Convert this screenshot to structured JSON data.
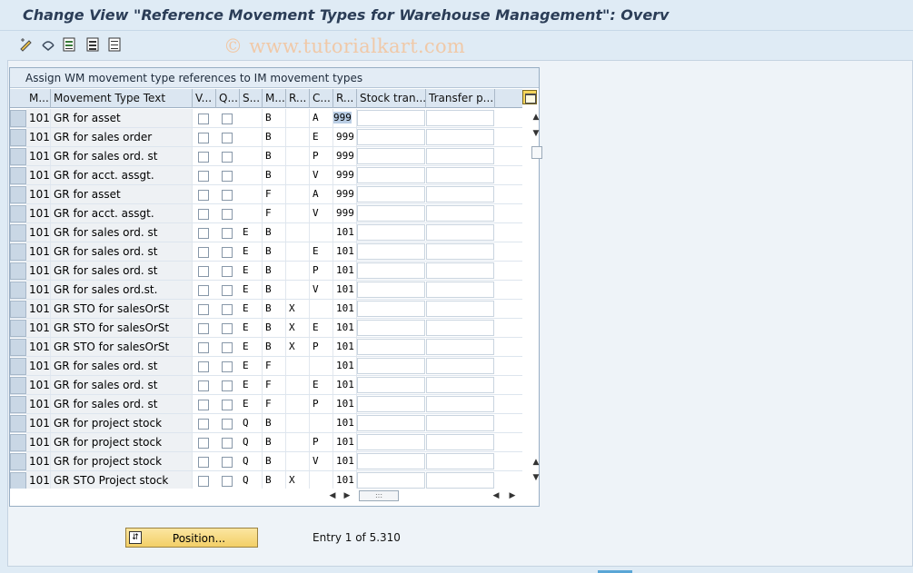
{
  "title": "Change View \"Reference Movement Types for Warehouse Management\": Overv",
  "watermark": "© www.tutorialkart.com",
  "toolbar": {
    "icons": [
      "change-display-icon",
      "other-view-icon",
      "details-icon",
      "select-all-icon",
      "deselect-icon"
    ]
  },
  "table": {
    "caption": "Assign WM movement type references to IM movement types",
    "columns": [
      "M...",
      "Movement Type Text",
      "V...",
      "Q...",
      "S...",
      "M...",
      "R...",
      "C...",
      "R...",
      "Stock tran...",
      "Transfer p..."
    ],
    "rows": [
      {
        "mvt": "101",
        "text": "GR for asset",
        "s": "",
        "m": "B",
        "r": "",
        "c": "A",
        "ref": "999"
      },
      {
        "mvt": "101",
        "text": "GR for sales order",
        "s": "",
        "m": "B",
        "r": "",
        "c": "E",
        "ref": "999"
      },
      {
        "mvt": "101",
        "text": "GR for sales ord. st",
        "s": "",
        "m": "B",
        "r": "",
        "c": "P",
        "ref": "999"
      },
      {
        "mvt": "101",
        "text": "GR for acct. assgt.",
        "s": "",
        "m": "B",
        "r": "",
        "c": "V",
        "ref": "999"
      },
      {
        "mvt": "101",
        "text": "GR for asset",
        "s": "",
        "m": "F",
        "r": "",
        "c": "A",
        "ref": "999"
      },
      {
        "mvt": "101",
        "text": "GR for acct. assgt.",
        "s": "",
        "m": "F",
        "r": "",
        "c": "V",
        "ref": "999"
      },
      {
        "mvt": "101",
        "text": "GR for sales ord. st",
        "s": "E",
        "m": "B",
        "r": "",
        "c": "",
        "ref": "101"
      },
      {
        "mvt": "101",
        "text": "GR for sales ord. st",
        "s": "E",
        "m": "B",
        "r": "",
        "c": "E",
        "ref": "101"
      },
      {
        "mvt": "101",
        "text": "GR for sales ord. st",
        "s": "E",
        "m": "B",
        "r": "",
        "c": "P",
        "ref": "101"
      },
      {
        "mvt": "101",
        "text": "GR for sales ord.st.",
        "s": "E",
        "m": "B",
        "r": "",
        "c": "V",
        "ref": "101"
      },
      {
        "mvt": "101",
        "text": "GR STO for salesOrSt",
        "s": "E",
        "m": "B",
        "r": "X",
        "c": "",
        "ref": "101"
      },
      {
        "mvt": "101",
        "text": "GR STO for salesOrSt",
        "s": "E",
        "m": "B",
        "r": "X",
        "c": "E",
        "ref": "101"
      },
      {
        "mvt": "101",
        "text": "GR STO for salesOrSt",
        "s": "E",
        "m": "B",
        "r": "X",
        "c": "P",
        "ref": "101"
      },
      {
        "mvt": "101",
        "text": "GR for sales ord. st",
        "s": "E",
        "m": "F",
        "r": "",
        "c": "",
        "ref": "101"
      },
      {
        "mvt": "101",
        "text": "GR for sales ord. st",
        "s": "E",
        "m": "F",
        "r": "",
        "c": "E",
        "ref": "101"
      },
      {
        "mvt": "101",
        "text": "GR for sales ord. st",
        "s": "E",
        "m": "F",
        "r": "",
        "c": "P",
        "ref": "101"
      },
      {
        "mvt": "101",
        "text": "GR for project stock",
        "s": "Q",
        "m": "B",
        "r": "",
        "c": "",
        "ref": "101"
      },
      {
        "mvt": "101",
        "text": "GR for project stock",
        "s": "Q",
        "m": "B",
        "r": "",
        "c": "P",
        "ref": "101"
      },
      {
        "mvt": "101",
        "text": "GR for project stock",
        "s": "Q",
        "m": "B",
        "r": "",
        "c": "V",
        "ref": "101"
      },
      {
        "mvt": "101",
        "text": "GR STO Project stock",
        "s": "Q",
        "m": "B",
        "r": "X",
        "c": "",
        "ref": "101"
      }
    ]
  },
  "position_button": "Position...",
  "entry_info": "Entry 1 of 5.310",
  "colors": {
    "title": "#2b3d57",
    "background": "#dfebf5",
    "button": "#f3cf67",
    "selected_cell": "#b9cde4"
  }
}
